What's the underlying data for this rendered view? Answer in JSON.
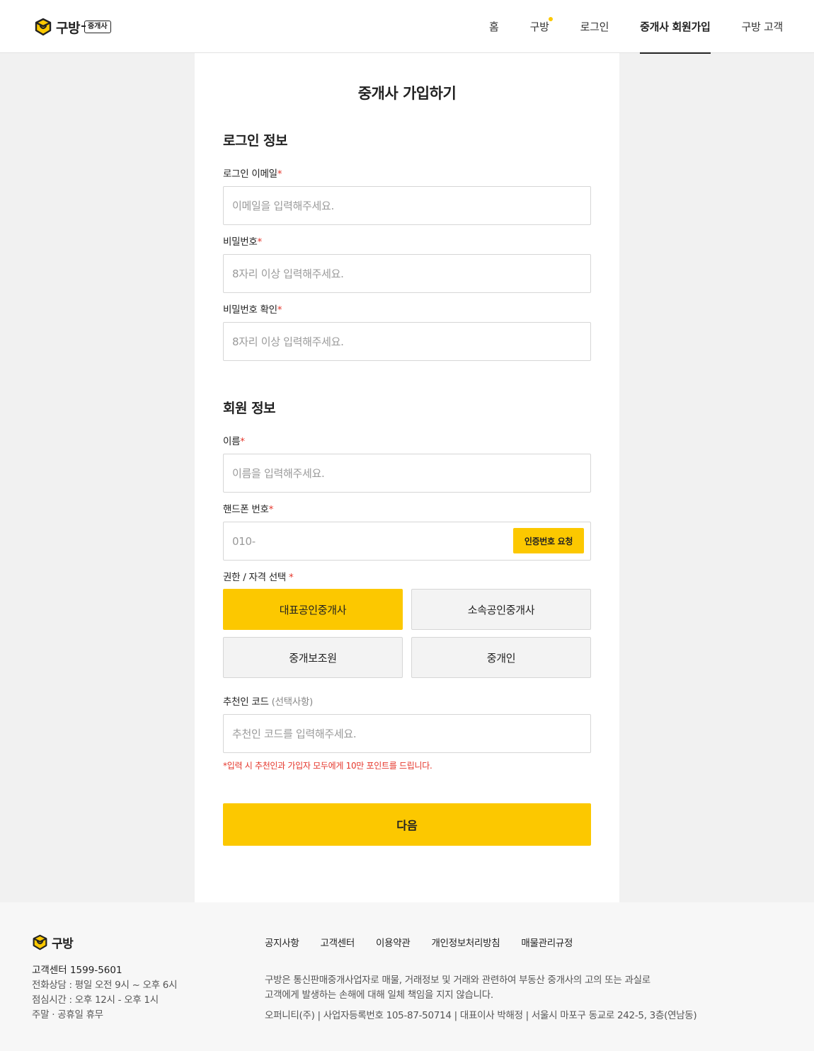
{
  "brand": {
    "name": "구방",
    "badge": "중개사"
  },
  "nav": {
    "home": "홈",
    "gubang": "구방",
    "login": "로그인",
    "signup": "중개사 회원가입",
    "customer": "구방 고객"
  },
  "page": {
    "title": "중개사 가입하기"
  },
  "login_section": {
    "title": "로그인 정보",
    "email_label": "로그인 이메일",
    "email_placeholder": "이메일을 입력해주세요.",
    "password_label": "비밀번호",
    "password_placeholder": "8자리 이상 입력해주세요.",
    "password_confirm_label": "비밀번호 확인",
    "password_confirm_placeholder": "8자리 이상 입력해주세요."
  },
  "member_section": {
    "title": "회원 정보",
    "name_label": "이름",
    "name_placeholder": "이름을 입력해주세요.",
    "phone_label": "핸드폰 번호",
    "phone_placeholder": "010-",
    "verify_button": "인증번호 요청",
    "role_label": "권한 / 자격 선택",
    "roles": [
      "대표공인중개사",
      "소속공인중개사",
      "중개보조원",
      "중개인"
    ],
    "selected_role": "대표공인중개사",
    "referral_label": "추천인 코드",
    "referral_optional": "(선택사항)",
    "referral_placeholder": "추천인 코드를 입력해주세요.",
    "referral_note": "*입력 시 추천인과 가입자 모두에게 10만 포인트를 드립니다.",
    "required_mark": "*"
  },
  "next_button": "다음",
  "footer": {
    "brand": "구방",
    "cs_title": "고객센터 1599-5601",
    "cs_hours": "전화상담 : 평일 오전 9시 ~ 오후 6시",
    "cs_lunch": "점심시간 : 오후 12시 - 오후 1시",
    "cs_closed": "주말 · 공휴일 휴무",
    "links": [
      "공지사항",
      "고객센터",
      "이용약관",
      "개인정보처리방침",
      "매물관리규정"
    ],
    "disclaimer_1": "구방은 통신판매중개사업자로 매물, 거래정보 및 거래와 관련하여 부동산 중개사의 고의 또는 과실로",
    "disclaimer_2": "고객에게 발생하는 손해에 대해 일체 책임을 지지 않습니다.",
    "company": "오퍼니티(주) | 사업자등록번호 105-87-50714 | 대표이사 박해정 | 서울시 마포구 동교로 242-5, 3층(연남동)"
  },
  "colors": {
    "accent": "#fcc800",
    "required": "#e5372c",
    "background": "#f1f1f1"
  }
}
